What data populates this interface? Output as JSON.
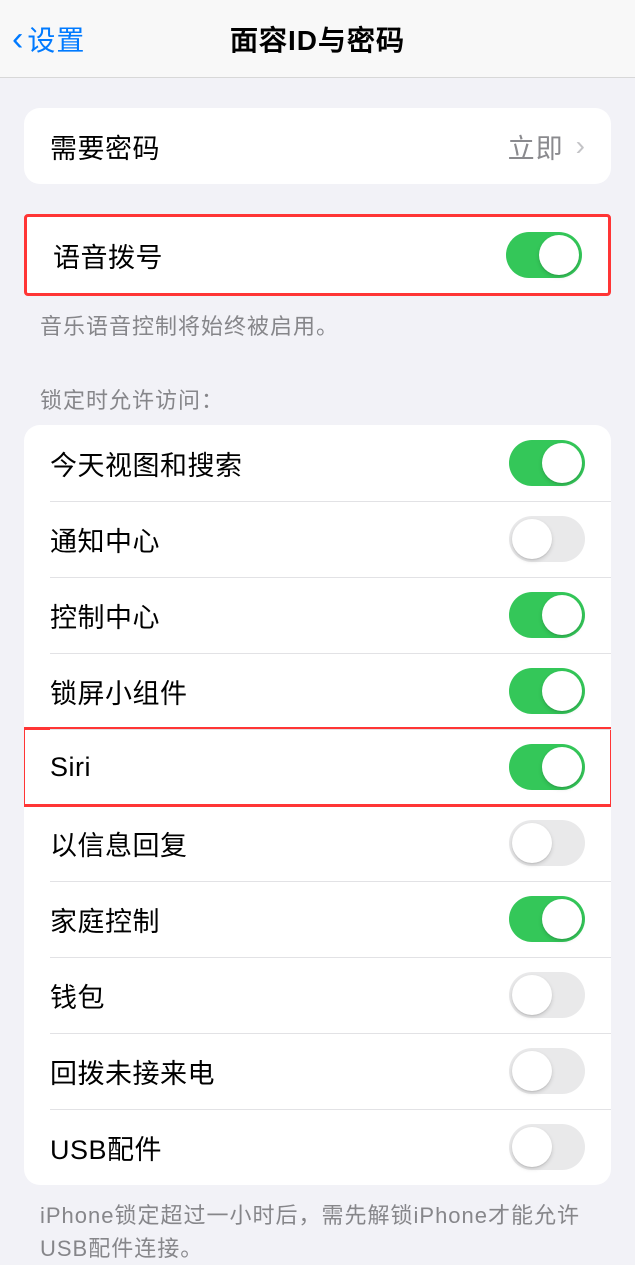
{
  "nav": {
    "back_label": "设置",
    "title": "面容ID与密码"
  },
  "require_passcode": {
    "label": "需要密码",
    "value": "立即"
  },
  "voice_dial": {
    "label": "语音拨号",
    "enabled": true,
    "footer": "音乐语音控制将始终被启用。"
  },
  "lock_screen_access": {
    "header": "锁定时允许访问：",
    "items": [
      {
        "label": "今天视图和搜索",
        "enabled": true
      },
      {
        "label": "通知中心",
        "enabled": false
      },
      {
        "label": "控制中心",
        "enabled": true
      },
      {
        "label": "锁屏小组件",
        "enabled": true
      },
      {
        "label": "Siri",
        "enabled": true
      },
      {
        "label": "以信息回复",
        "enabled": false
      },
      {
        "label": "家庭控制",
        "enabled": true
      },
      {
        "label": "钱包",
        "enabled": false
      },
      {
        "label": "回拨未接来电",
        "enabled": false
      },
      {
        "label": "USB配件",
        "enabled": false
      }
    ],
    "footer": "iPhone锁定超过一小时后，需先解锁iPhone才能允许USB配件连接。"
  }
}
